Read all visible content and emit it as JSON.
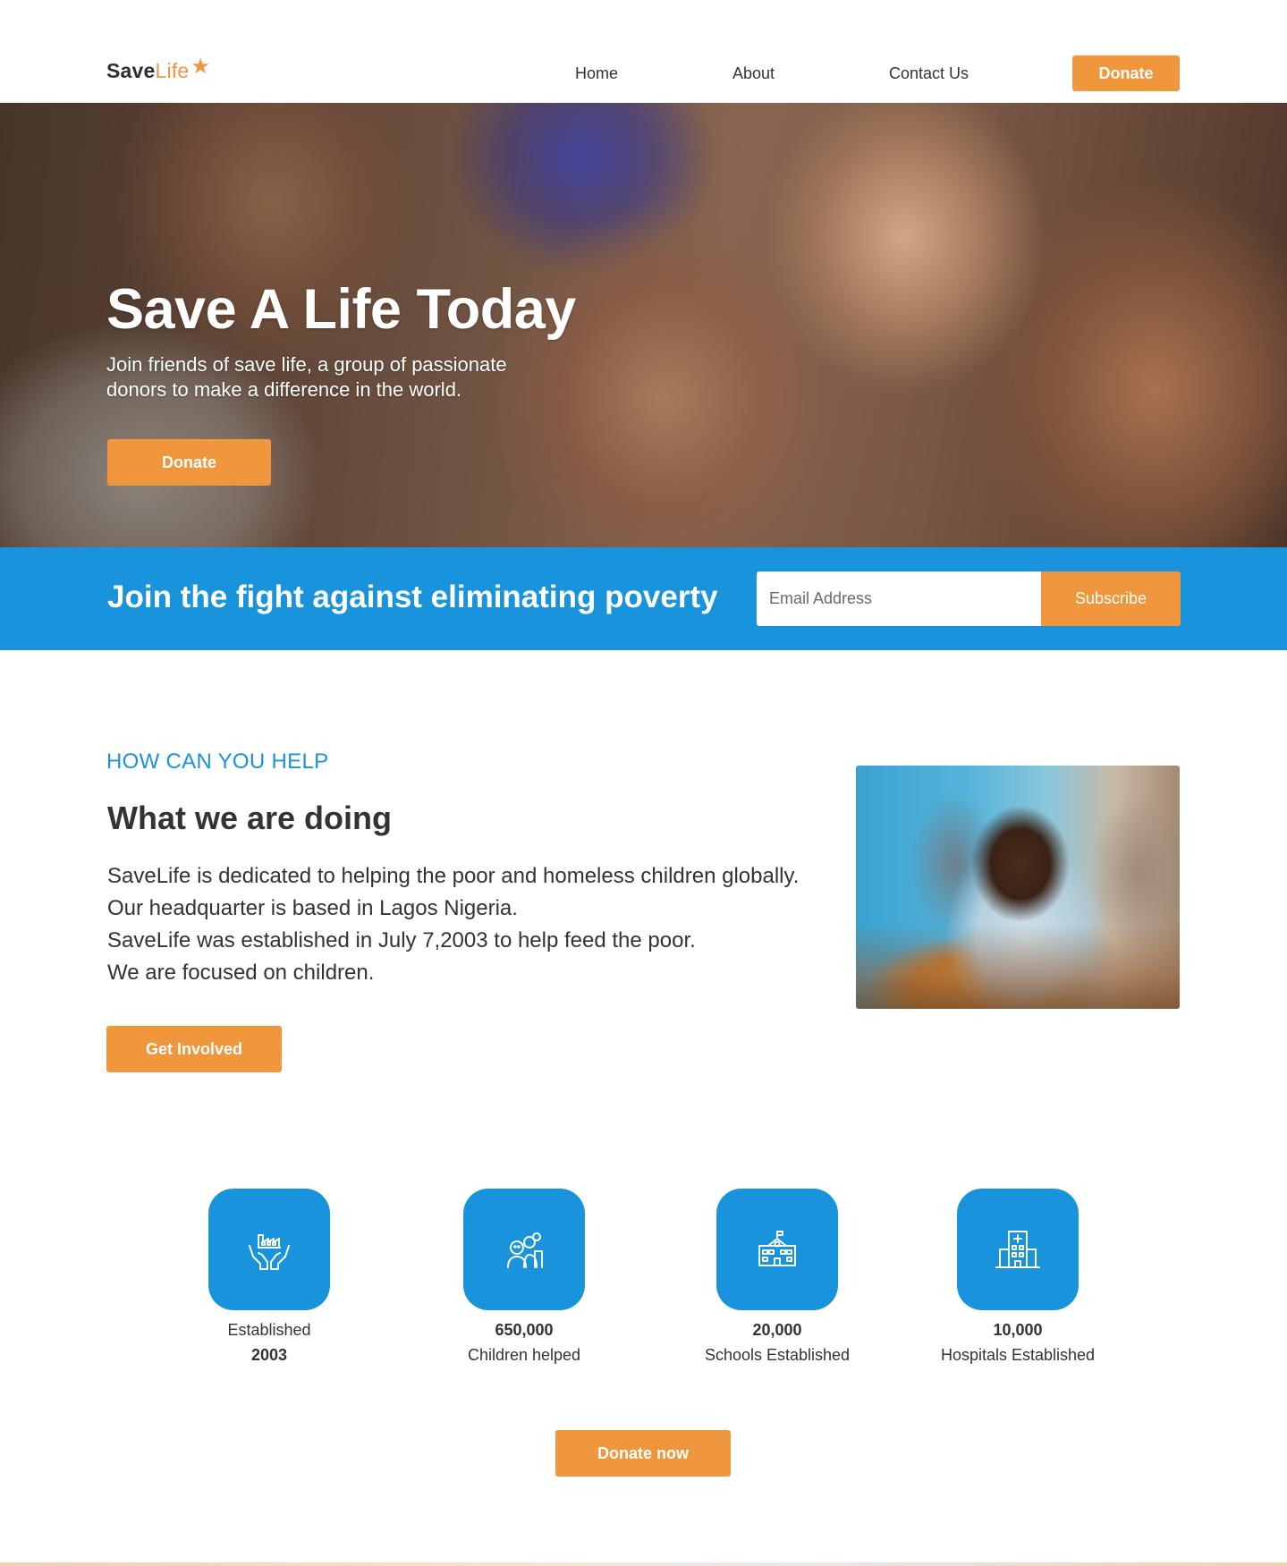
{
  "header": {
    "logo": {
      "save": "Save",
      "life": "Life",
      "star": "★"
    },
    "nav": [
      {
        "label": "Home"
      },
      {
        "label": "About"
      },
      {
        "label": "Contact Us"
      }
    ],
    "donate_label": "Donate"
  },
  "hero": {
    "title": "Save A Life Today",
    "subtitle": "Join friends of save life, a group of passionate donors to make a difference in the world.",
    "donate_label": "Donate"
  },
  "subscribe": {
    "title": "Join the fight against eliminating poverty",
    "email_placeholder": "Email Address",
    "button_label": "Subscribe"
  },
  "help": {
    "kicker": "HOW CAN YOU HELP",
    "title": "What we are doing",
    "lines": [
      "SaveLife is dedicated to helping the poor and homeless children globally.",
      "Our headquarter is based in Lagos Nigeria.",
      "SaveLife was established in July 7,2003 to help feed the poor.",
      "We are focused on children."
    ],
    "button_label": "Get Involved"
  },
  "stats": [
    {
      "icon": "hands-factory-icon",
      "line1": "Established",
      "line2": "2003",
      "bold_line": 2
    },
    {
      "icon": "children-group-icon",
      "line1": "650,000",
      "line2": "Children helped",
      "bold_line": 1
    },
    {
      "icon": "school-building-icon",
      "line1": "20,000",
      "line2": "Schools Established",
      "bold_line": 1
    },
    {
      "icon": "hospital-building-icon",
      "line1": "10,000",
      "line2": "Hospitals Established",
      "bold_line": 1
    }
  ],
  "cta": {
    "donate_now_label": "Donate now"
  },
  "colors": {
    "accent_orange": "#f0963c",
    "brand_blue": "#1a93dd",
    "text": "#333333"
  }
}
